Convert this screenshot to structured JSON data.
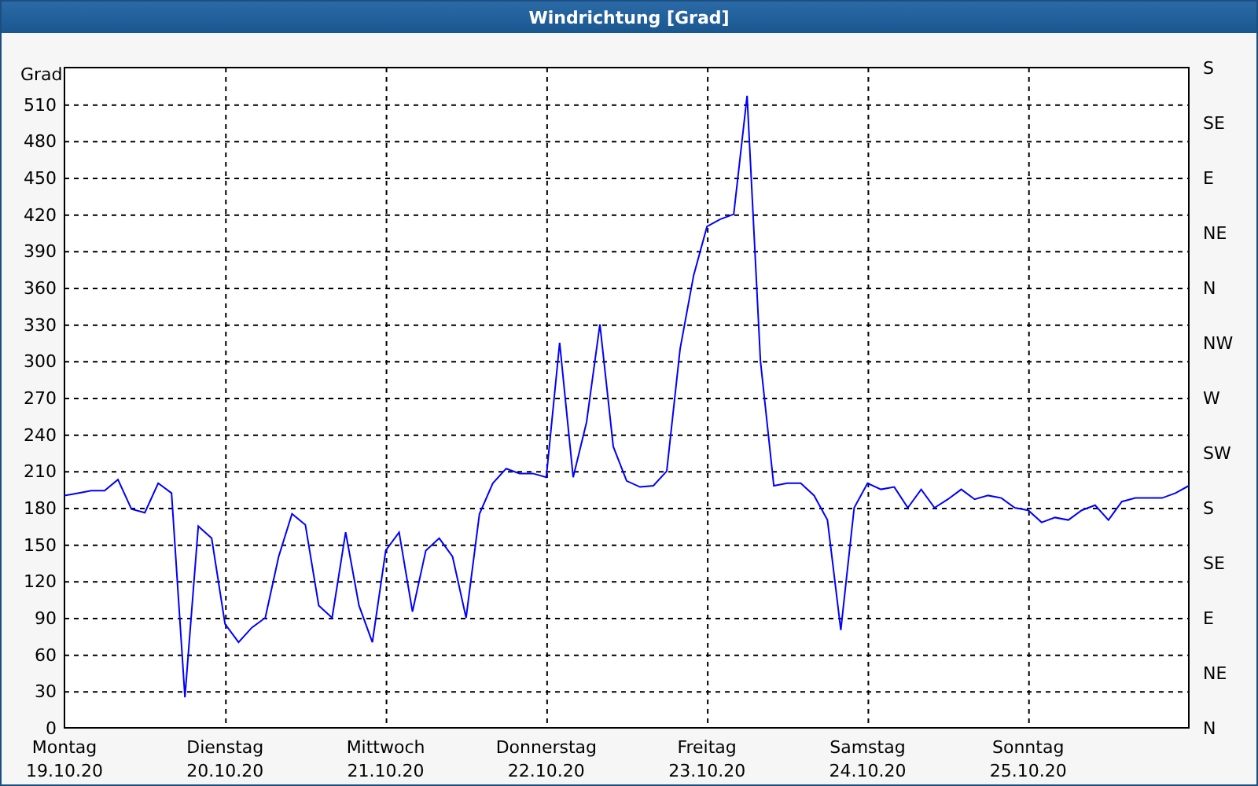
{
  "window": {
    "title": "Windrichtung [Grad]"
  },
  "chart": {
    "right_ticks": [
      "S",
      "SE",
      "E",
      "NE",
      "N",
      "NW",
      "W",
      "SW",
      "S",
      "SE",
      "E",
      "NE",
      "N"
    ],
    "chart_data": {
      "type": "line",
      "ylabel": "Grad",
      "grid": true,
      "ylim": [
        0,
        540
      ],
      "yticks": [
        0,
        30,
        60,
        90,
        120,
        150,
        180,
        210,
        240,
        270,
        300,
        330,
        360,
        390,
        420,
        450,
        480,
        510
      ],
      "categories": [
        "Montag\n19.10.20",
        null,
        null,
        null,
        null,
        null,
        null,
        null,
        null,
        null,
        null,
        null,
        "Dienstag\n20.10.20",
        null,
        null,
        null,
        null,
        null,
        null,
        null,
        null,
        null,
        null,
        null,
        "Mittwoch\n21.10.20",
        null,
        null,
        null,
        null,
        null,
        null,
        null,
        null,
        null,
        null,
        null,
        "Donnerstag\n22.10.20",
        null,
        null,
        null,
        null,
        null,
        null,
        null,
        null,
        null,
        null,
        null,
        "Freitag\n23.10.20",
        null,
        null,
        null,
        null,
        null,
        null,
        null,
        null,
        null,
        null,
        null,
        "Samstag\n24.10.20",
        null,
        null,
        null,
        null,
        null,
        null,
        null,
        null,
        null,
        null,
        null,
        "Sonntag\n25.10.20",
        null,
        null,
        null,
        null,
        null,
        null,
        null,
        null,
        null,
        null,
        null,
        null
      ],
      "series": [
        {
          "color": "#0000ff",
          "values": [
            190,
            192,
            194,
            194,
            203,
            179,
            176,
            200,
            192,
            25,
            165,
            155,
            85,
            70,
            82,
            90,
            140,
            175,
            166,
            100,
            90,
            160,
            100,
            70,
            145,
            160,
            95,
            145,
            155,
            140,
            90,
            175,
            200,
            212,
            208,
            208,
            205,
            315,
            205,
            250,
            330,
            230,
            202,
            197,
            198,
            210,
            310,
            370,
            410,
            416,
            420,
            517,
            300,
            198,
            200,
            200,
            190,
            170,
            80,
            180,
            200,
            195,
            197,
            180,
            195,
            180,
            187,
            195,
            187,
            190,
            188,
            180,
            178,
            168,
            172,
            170,
            178,
            182,
            170,
            185,
            188,
            188,
            188,
            192,
            198
          ]
        }
      ]
    }
  }
}
